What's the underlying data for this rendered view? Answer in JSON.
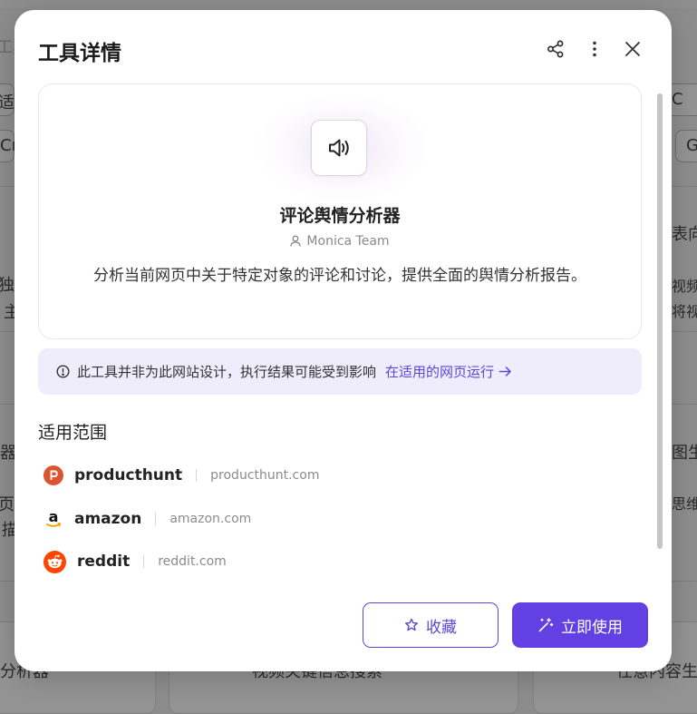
{
  "background": {
    "fragments": [
      "工具",
      "适用",
      "Cr",
      "C",
      "G",
      "表向",
      "独特",
      "主",
      "视频",
      "将视",
      "器",
      "图生",
      "页上",
      "描",
      "思维",
      "分析器",
      "视频关键信息搜索",
      "任意内容生"
    ]
  },
  "modal": {
    "title": "工具详情",
    "share_icon": "share-icon",
    "more_icon": "more-vertical-icon",
    "close_icon": "close-icon"
  },
  "tool": {
    "icon": "speaker-icon",
    "name": "评论舆情分析器",
    "author": "Monica Team",
    "description": "分析当前网页中关于特定对象的评论和讨论，提供全面的舆情分析报告。"
  },
  "warning": {
    "text": "此工具并非为此网站设计，执行结果可能受到影响",
    "link": "在适用的网页运行"
  },
  "scope": {
    "title": "适用范围",
    "sites": [
      {
        "name": "producthunt",
        "domain": "producthunt.com",
        "color": "#da552f"
      },
      {
        "name": "amazon",
        "domain": "amazon.com",
        "color": "#ff9900"
      },
      {
        "name": "reddit",
        "domain": "reddit.com",
        "color": "#ff4500"
      }
    ]
  },
  "actions": {
    "favorite_label": "收藏",
    "use_label": "立即使用"
  },
  "colors": {
    "accent": "#6240e3",
    "warn_bg": "#efedfc"
  }
}
